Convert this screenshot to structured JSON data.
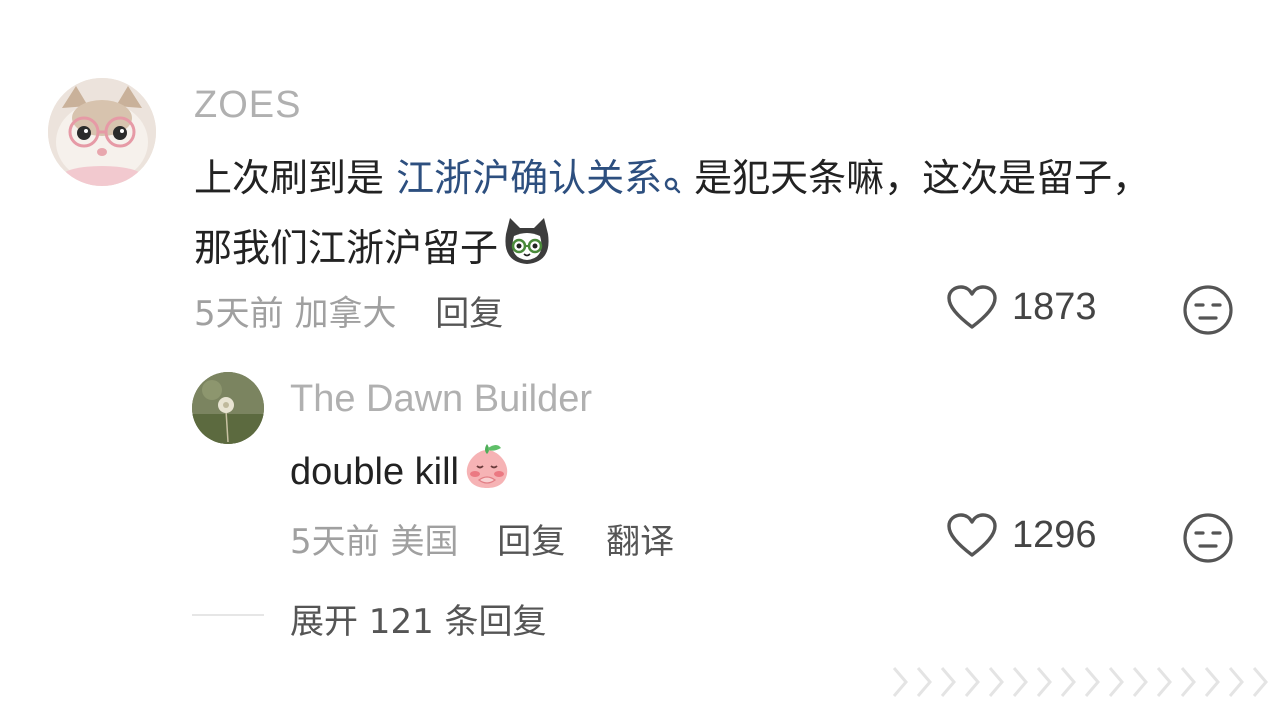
{
  "comment": {
    "username": "ZOES",
    "text_before": "上次刷到是 ",
    "link_text": "江浙沪确认关系",
    "text_after": "是犯天条嘛，这次是留子，那我们江浙沪留子",
    "time": "5天前",
    "location": "加拿大",
    "reply_label": "回复",
    "likes": "1873",
    "icons": [
      "search-icon",
      "cat-emoji-icon",
      "heart-icon",
      "expressionless-face-icon"
    ]
  },
  "reply": {
    "username": "The Dawn Builder",
    "text": "double kill",
    "time": "5天前",
    "location": "美国",
    "reply_label": "回复",
    "translate_label": "翻译",
    "likes": "1296",
    "icons": [
      "peach-emoji-icon",
      "heart-icon",
      "expressionless-face-icon"
    ]
  },
  "expand": {
    "label": "展开 121 条回复"
  },
  "colors": {
    "link": "#2d4f7f",
    "meta": "#a0a0a0",
    "username": "#b0b0b0"
  }
}
